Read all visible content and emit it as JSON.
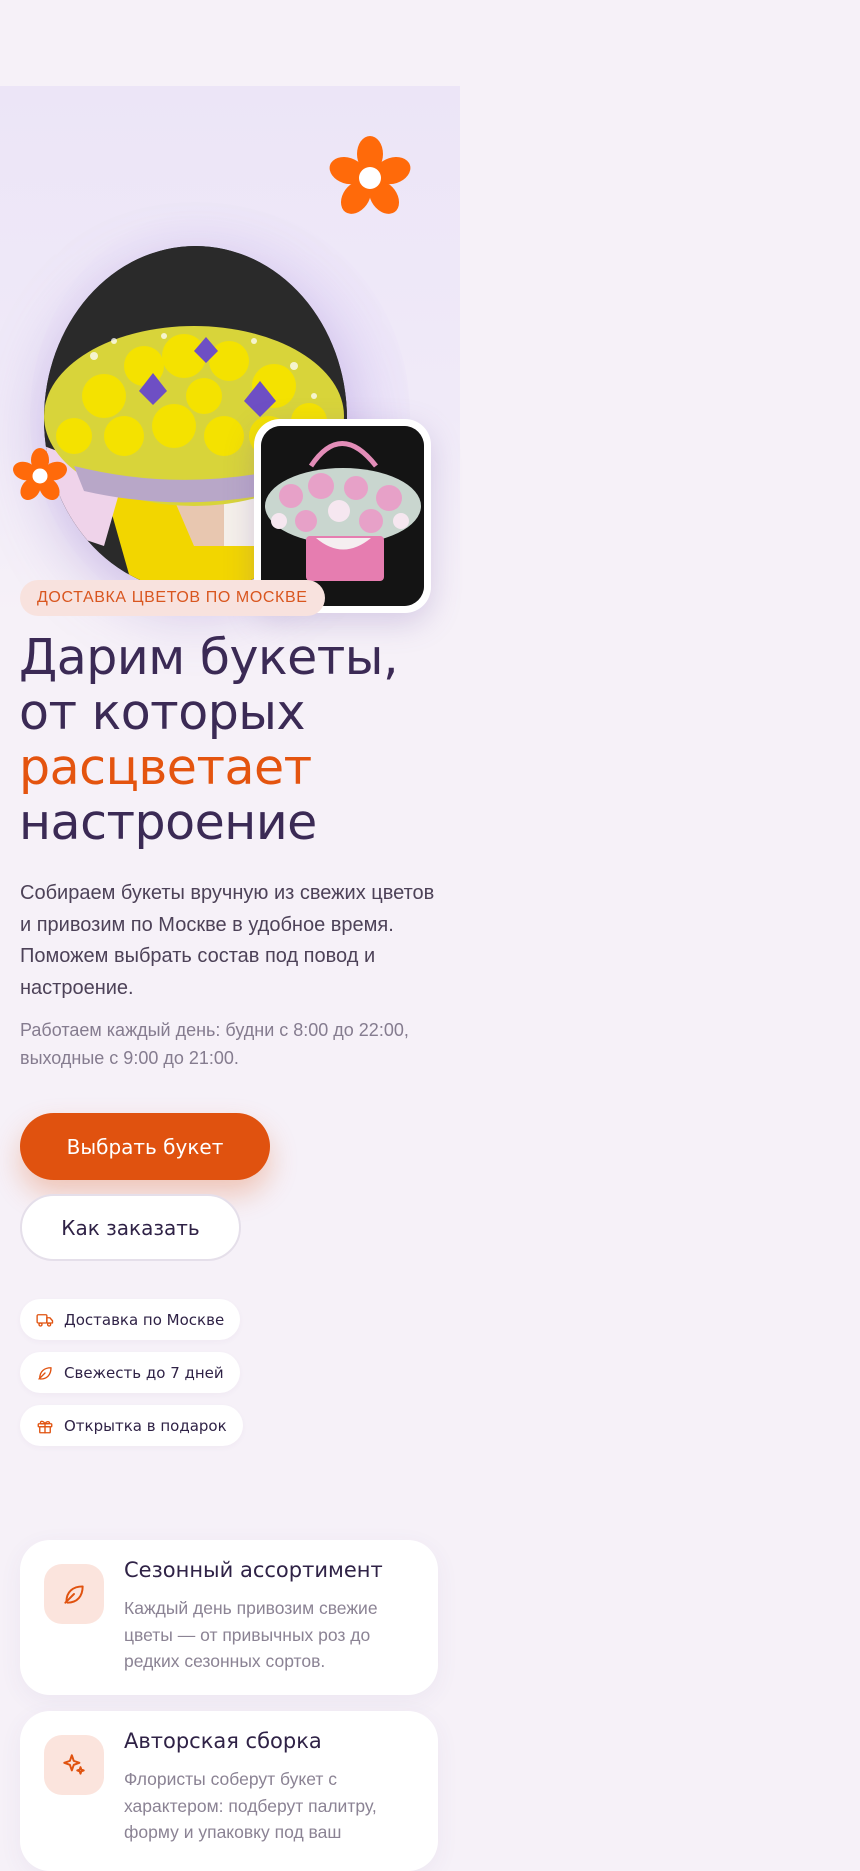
{
  "hero": {
    "badge": "ДОСТАВКА ЦВЕТОВ ПО МОСКВЕ",
    "title_line1": "Дарим букеты,",
    "title_line2": "от которых",
    "title_accent": "расцветает",
    "title_line4": "настроение",
    "lead": "Собираем букеты вручную из свежих цветов и привозим по Москве в удобное время. Поможем выбрать состав под повод и настроение.",
    "hours": "Работаем каждый день: будни с 8:00 до 22:00, выходные с 9:00 до 21:00.",
    "primary_button": "Выбрать букет",
    "secondary_button": "Как заказать"
  },
  "chips": [
    {
      "label": "Доставка по Москве",
      "icon": "truck-icon"
    },
    {
      "label": "Свежесть до 7 дней",
      "icon": "leaf-icon"
    },
    {
      "label": "Открытка в подарок",
      "icon": "gift-icon"
    }
  ],
  "features": [
    {
      "title": "Сезонный ассортимент",
      "text": "Каждый день привозим свежие цветы — от привычных роз до редких сезонных сортов.",
      "icon": "leaf-icon"
    },
    {
      "title": "Авторская сборка",
      "text": "Флористы соберут букет с характером: подберут палитру, форму и упаковку под ваш",
      "icon": "sparkle-icon"
    }
  ],
  "colors": {
    "accent": "#e0520f",
    "background": "#f6f1f8",
    "text": "#2f2246",
    "decor_flower": "#ff6a0a"
  }
}
